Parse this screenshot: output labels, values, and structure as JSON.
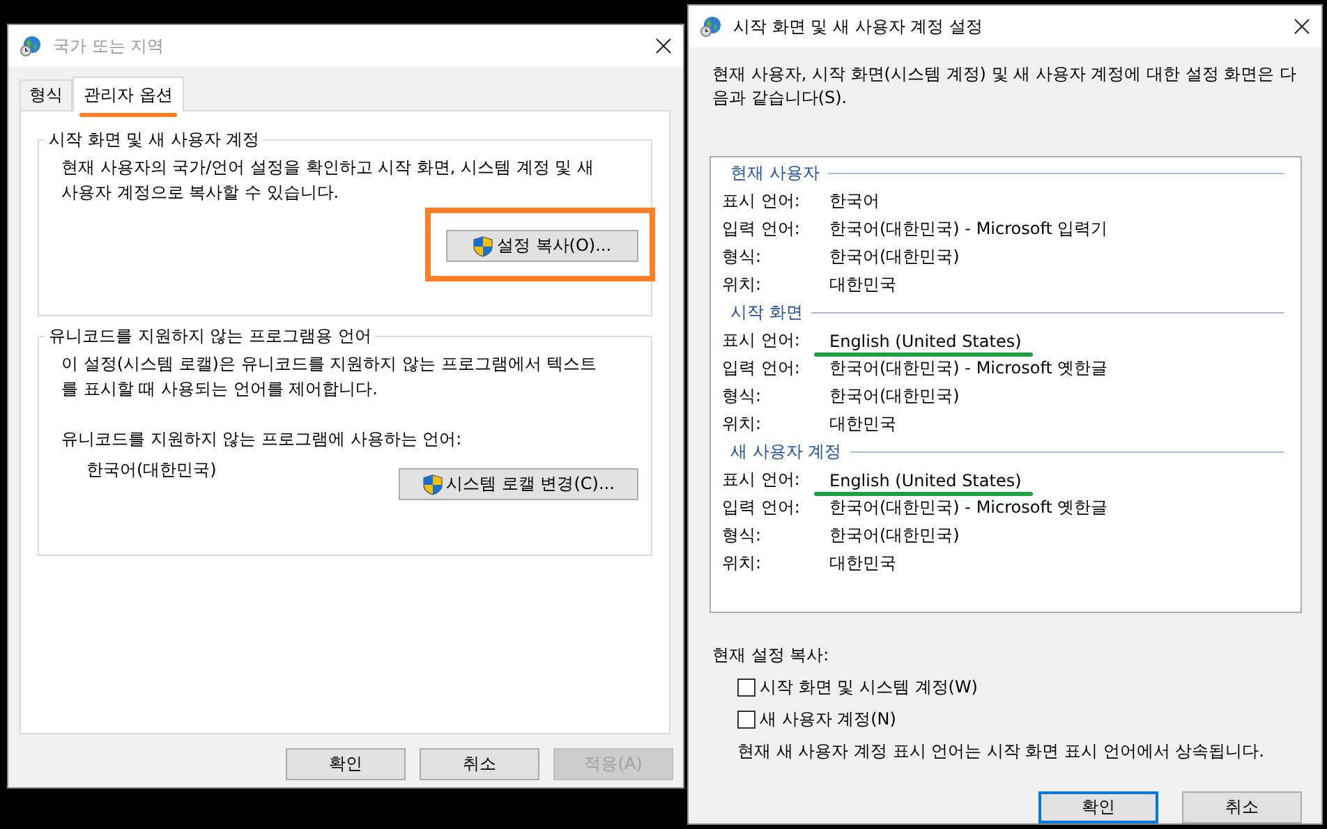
{
  "region_dialog": {
    "title": "국가 또는 지역",
    "tabs": [
      {
        "label": "형식",
        "selected": false,
        "highlighted": false
      },
      {
        "label": "관리자 옵션",
        "selected": true,
        "highlighted": true
      }
    ],
    "groups": [
      {
        "title": "시작 화면 및 새 사용자 계정",
        "description": "현재 사용자의 국가/언어 설정을 확인하고 시작 화면, 시스템 계정 및 새 사용자 계정으로 복사할 수 있습니다.",
        "button": {
          "label": "설정 복사(O)...",
          "highlighted": true
        }
      },
      {
        "title": "유니코드를 지원하지 않는 프로그램용 언어",
        "description": "이 설정(시스템 로캘)은 유니코드를 지원하지 않는 프로그램에서 텍스트를 표시할 때 사용되는 언어를 제어합니다.",
        "caption": "유니코드를 지원하지 않는 프로그램에 사용하는 언어:",
        "value": "한국어(대한민국)",
        "button": {
          "label": "시스템 로캘 변경(C)...",
          "highlighted": false
        }
      }
    ],
    "buttons": [
      {
        "label": "확인",
        "disabled": false
      },
      {
        "label": "취소",
        "disabled": false
      },
      {
        "label": "적용(A)",
        "disabled": true
      }
    ]
  },
  "copy_dialog": {
    "title": "시작 화면 및 새 사용자 계정 설정",
    "intro": "현재 사용자, 시작 화면(시스템 계정) 및 새 사용자 계정에 대한 설정 화면은 다음과 같습니다(S).",
    "sections": [
      {
        "title": "현재 사용자",
        "rows": [
          {
            "label": "표시 언어:",
            "value": "한국어",
            "underlined": false
          },
          {
            "label": "입력 언어:",
            "value": "한국어(대한민국) - Microsoft 입력기",
            "underlined": false
          },
          {
            "label": "형식:",
            "value": "한국어(대한민국)",
            "underlined": false
          },
          {
            "label": "위치:",
            "value": "대한민국",
            "underlined": false
          }
        ]
      },
      {
        "title": "시작 화면",
        "rows": [
          {
            "label": "표시 언어:",
            "value": "English (United States)",
            "underlined": true
          },
          {
            "label": "입력 언어:",
            "value": "한국어(대한민국) - Microsoft 옛한글",
            "underlined": false
          },
          {
            "label": "형식:",
            "value": "한국어(대한민국)",
            "underlined": false
          },
          {
            "label": "위치:",
            "value": "대한민국",
            "underlined": false
          }
        ]
      },
      {
        "title": "새 사용자 계정",
        "rows": [
          {
            "label": "표시 언어:",
            "value": "English (United States)",
            "underlined": true
          },
          {
            "label": "입력 언어:",
            "value": "한국어(대한민국) - Microsoft 옛한글",
            "underlined": false
          },
          {
            "label": "형식:",
            "value": "한국어(대한민국)",
            "underlined": false
          },
          {
            "label": "위치:",
            "value": "대한민국",
            "underlined": false
          }
        ]
      }
    ],
    "copy_label": "현재 설정 복사:",
    "options": [
      {
        "label": "시작 화면 및 시스템 계정(W)",
        "checked": false
      },
      {
        "label": "새 사용자 계정(N)",
        "checked": false
      }
    ],
    "note": "현재 새 사용자 계정 표시 언어는 시작 화면 표시 언어에서 상속됩니다.",
    "buttons": [
      {
        "label": "확인",
        "default": true
      },
      {
        "label": "취소",
        "default": false
      }
    ]
  }
}
